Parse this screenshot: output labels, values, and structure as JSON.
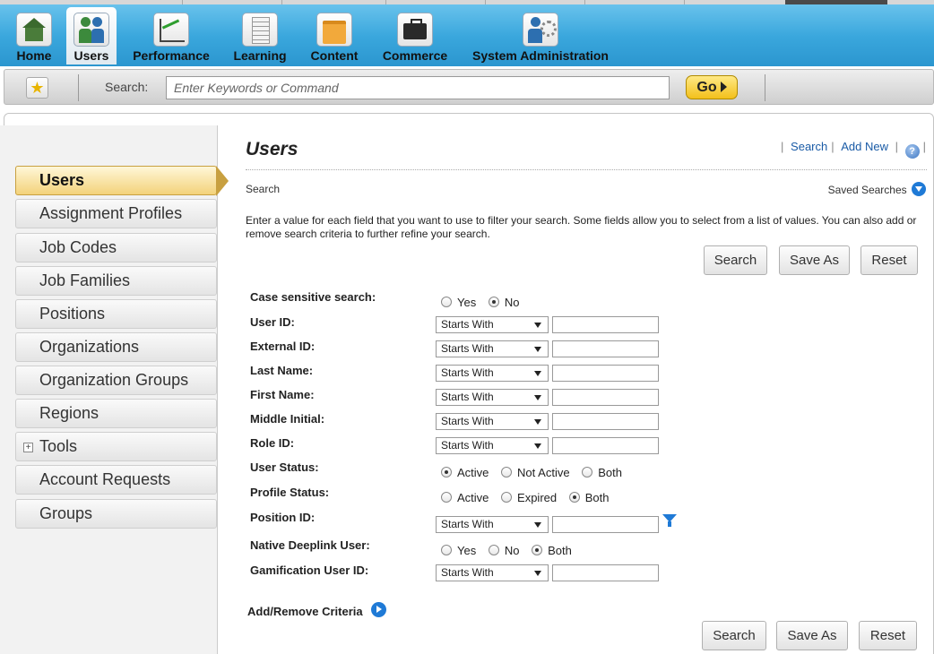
{
  "nav": {
    "tabs": [
      {
        "label": "Home",
        "icon": "home-icon"
      },
      {
        "label": "Users",
        "icon": "users-icon"
      },
      {
        "label": "Performance",
        "icon": "performance-chart-icon"
      },
      {
        "label": "Learning",
        "icon": "learning-document-icon"
      },
      {
        "label": "Content",
        "icon": "content-folder-icon"
      },
      {
        "label": "Commerce",
        "icon": "briefcase-icon"
      },
      {
        "label": "System Administration",
        "icon": "system-admin-icon"
      }
    ],
    "active": "Users"
  },
  "searchbar": {
    "label": "Search:",
    "placeholder": "Enter Keywords or Command",
    "go_label": "Go"
  },
  "sidebar": {
    "items": [
      {
        "label": "Users"
      },
      {
        "label": "Assignment Profiles"
      },
      {
        "label": "Job Codes"
      },
      {
        "label": "Job Families"
      },
      {
        "label": "Positions"
      },
      {
        "label": "Organizations"
      },
      {
        "label": "Organization Groups"
      },
      {
        "label": "Regions"
      },
      {
        "label": "Tools"
      },
      {
        "label": "Account Requests"
      },
      {
        "label": "Groups"
      }
    ],
    "active": "Users"
  },
  "main": {
    "title": "Users",
    "links": {
      "search": "Search",
      "add_new": "Add New"
    },
    "section_label": "Search",
    "saved_searches": "Saved Searches",
    "instructions": "Enter a value for each field that you want to use to filter your search. Some fields allow you to select from a list of values. You can also add or remove search criteria to further refine your search.",
    "buttons": {
      "search": "Search",
      "save_as": "Save As",
      "reset": "Reset"
    },
    "criteria": {
      "case_sensitive": {
        "label": "Case sensitive search:",
        "options": [
          "Yes",
          "No"
        ],
        "selected": "No"
      },
      "user_id": {
        "label": "User ID:",
        "operator": "Starts With",
        "value": ""
      },
      "external_id": {
        "label": "External ID:",
        "operator": "Starts With",
        "value": ""
      },
      "last_name": {
        "label": "Last Name:",
        "operator": "Starts With",
        "value": ""
      },
      "first_name": {
        "label": "First Name:",
        "operator": "Starts With",
        "value": ""
      },
      "middle_initial": {
        "label": "Middle Initial:",
        "operator": "Starts With",
        "value": ""
      },
      "role_id": {
        "label": "Role ID:",
        "operator": "Starts With",
        "value": ""
      },
      "user_status": {
        "label": "User Status:",
        "options": [
          "Active",
          "Not Active",
          "Both"
        ],
        "selected": "Active"
      },
      "profile_status": {
        "label": "Profile Status:",
        "options": [
          "Active",
          "Expired",
          "Both"
        ],
        "selected": "Both"
      },
      "position_id": {
        "label": "Position ID:",
        "operator": "Starts With",
        "value": ""
      },
      "native_deeplink": {
        "label": "Native Deeplink User:",
        "options": [
          "Yes",
          "No",
          "Both"
        ],
        "selected": "Both"
      },
      "gamification_id": {
        "label": "Gamification User ID:",
        "operator": "Starts With",
        "value": ""
      }
    },
    "add_remove_label": "Add/Remove Criteria"
  }
}
